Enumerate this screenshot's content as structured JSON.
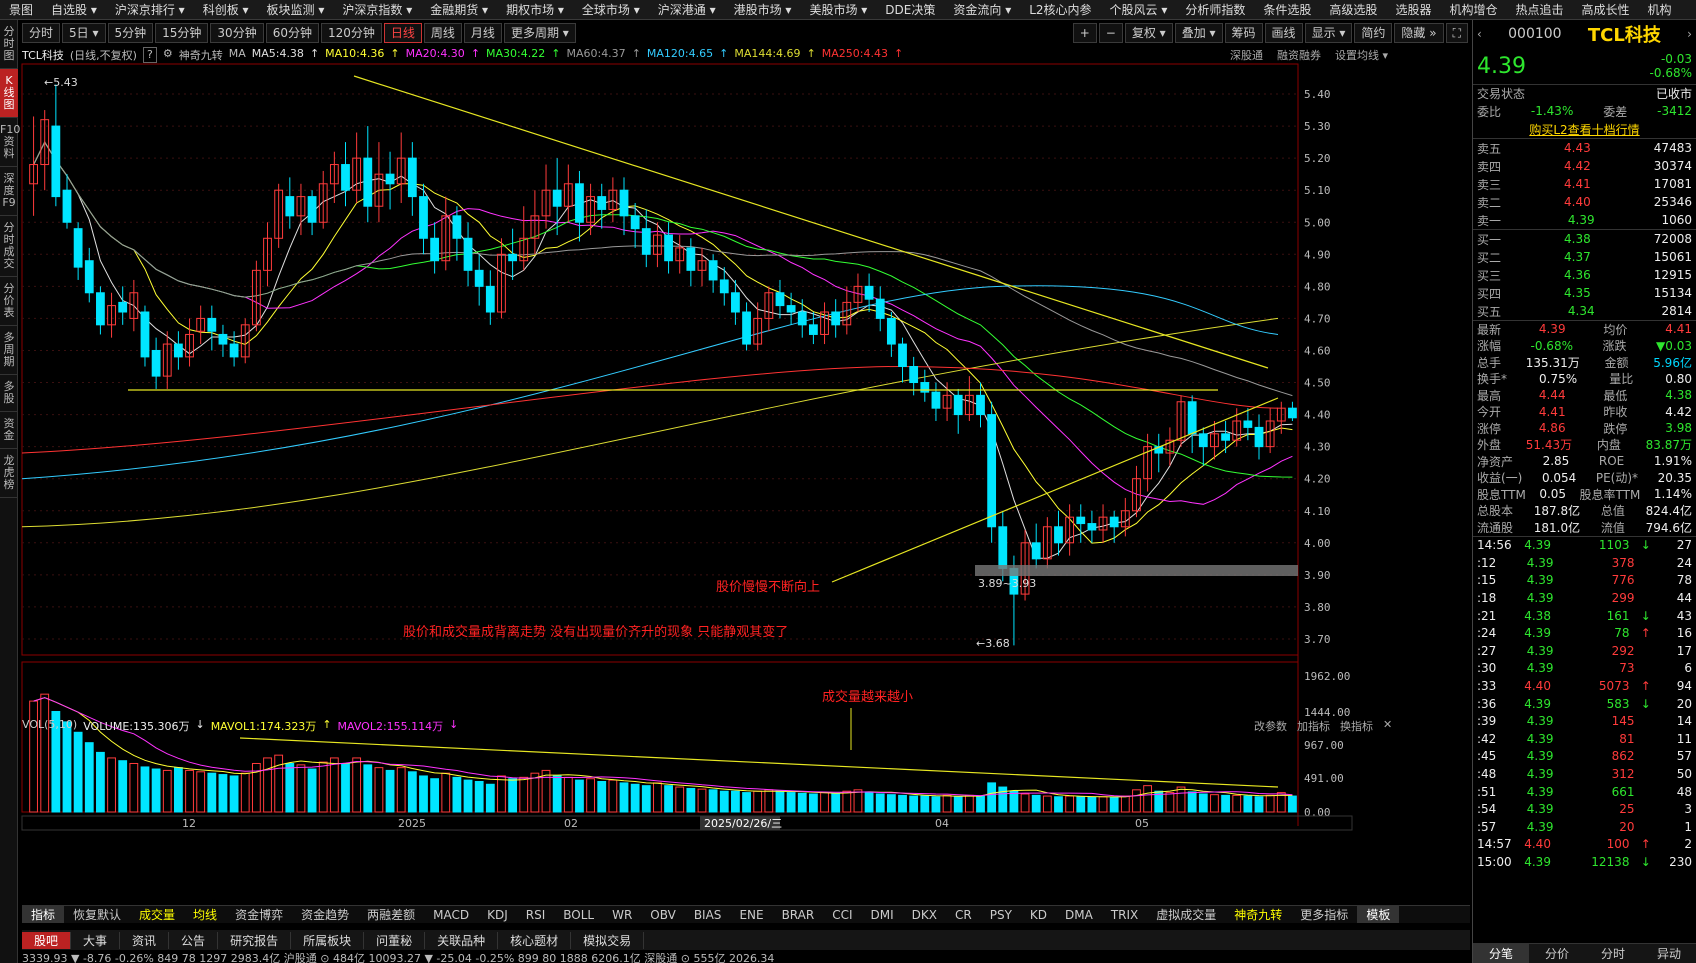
{
  "menu": [
    "景图",
    "自选股 ▾",
    "沪深京排行 ▾",
    "科创板 ▾",
    "板块监测 ▾",
    "沪深京指数 ▾",
    "金融期货 ▾",
    "期权市场 ▾",
    "全球市场 ▾",
    "沪深港通 ▾",
    "港股市场 ▾",
    "美股市场 ▾",
    "DDE决策",
    "资金流向 ▾",
    "L2核心内参",
    "个股风云 ▾",
    "分析师指数",
    "条件选股",
    "高级选股",
    "选股器",
    "机构增仓",
    "热点追击",
    "高成长性",
    "机构"
  ],
  "periods": [
    "分时",
    "5日 ▾",
    "5分钟",
    "15分钟",
    "30分钟",
    "60分钟",
    "120分钟",
    "日线",
    "周线",
    "月线",
    "更多周期 ▾"
  ],
  "active_period": "日线",
  "tools": [
    "+",
    "−",
    "复权 ▾",
    "叠加 ▾",
    "筹码",
    "画线",
    "显示 ▾",
    "简约",
    "隐藏 »",
    "⛶"
  ],
  "left_tabs": [
    "分时图",
    "K线图",
    "F10资料",
    "深度F9",
    "分时成交",
    "分价表",
    "多周期",
    "多股",
    "资金",
    "龙虎榜"
  ],
  "stock": {
    "name": "TCL科技",
    "mode": "(日线,不复权)",
    "code": "000100",
    "price": "4.39",
    "change": "-0.03",
    "pct": "-0.68%"
  },
  "indicator_name": "神奇九转",
  "ma_label": "MA",
  "ma_legend": [
    {
      "t": "MA5:4.38",
      "c": "#e0e0e0"
    },
    {
      "t": "MA10:4.36",
      "c": "#ffff33"
    },
    {
      "t": "MA20:4.30",
      "c": "#ff33ff"
    },
    {
      "t": "MA30:4.22",
      "c": "#33ff33"
    },
    {
      "t": "MA60:4.37",
      "c": "#999999"
    },
    {
      "t": "MA120:4.65",
      "c": "#33ccff"
    },
    {
      "t": "MA144:4.69",
      "c": "#dddd33"
    },
    {
      "t": "MA250:4.43",
      "c": "#ff3333"
    }
  ],
  "legend_right": [
    "深股通",
    "融资融券",
    "设置均线 ▾"
  ],
  "annotations": {
    "a1": "股价慢慢不断向上",
    "a2": "股价和成交量成背离走势 没有出现量价齐升的现象 只能静观其变了",
    "a3": "成交量越来越小",
    "box": "3.89~3.93",
    "high": "5.43",
    "low": "3.68"
  },
  "vol_legend": {
    "name": "VOL(5,10)",
    "v": "VOLUME:135.306万",
    "m1": "MAVOL1:174.323万",
    "m2": "MAVOL2:155.114万"
  },
  "vol_right": [
    "改参数",
    "加指标",
    "换指标"
  ],
  "date_cursor": "2025/02/26/三",
  "indicators": [
    "指标",
    "恢复默认",
    "成交量",
    "均线",
    "资金博弈",
    "资金趋势",
    "两融差额",
    "MACD",
    "KDJ",
    "RSI",
    "BOLL",
    "WR",
    "OBV",
    "BIAS",
    "ENE",
    "BRAR",
    "CCI",
    "DMI",
    "DKX",
    "CR",
    "PSY",
    "KD",
    "DMA",
    "TRIX",
    "虚拟成交量",
    "神奇九转",
    "更多指标",
    "模板"
  ],
  "bottom_tabs": [
    "股吧",
    "大事",
    "资讯",
    "公告",
    "研究报告",
    "所属板块",
    "问董秘",
    "关联品种",
    "核心题材",
    "模拟交易"
  ],
  "ticker": "3339.93   ▼ -8.76   -0.26%   849 78 1297   2983.4亿   沪股通 ⊙ 484亿   10093.27   ▼ -25.04   -0.25%   899 80 1888   6206.1亿   深股通 ⊙ 555亿   2026.34",
  "right": {
    "status_label": "交易状态",
    "status": "已收市",
    "weibi_label": "委比",
    "weibi": "-1.43%",
    "weicha_label": "委差",
    "weicha": "-3412",
    "buy_l2": "购买L2查看十档行情",
    "asks": [
      [
        "卖五",
        "4.43",
        "47483"
      ],
      [
        "卖四",
        "4.42",
        "30374"
      ],
      [
        "卖三",
        "4.41",
        "17081"
      ],
      [
        "卖二",
        "4.40",
        "25346"
      ],
      [
        "卖一",
        "4.39",
        "1060"
      ]
    ],
    "bids": [
      [
        "买一",
        "4.38",
        "72008"
      ],
      [
        "买二",
        "4.37",
        "15061"
      ],
      [
        "买三",
        "4.36",
        "12915"
      ],
      [
        "买四",
        "4.35",
        "15134"
      ],
      [
        "买五",
        "4.34",
        "2814"
      ]
    ],
    "stats": [
      [
        "最新",
        "4.39",
        "red",
        "均价",
        "4.41",
        "red"
      ],
      [
        "涨幅",
        "-0.68%",
        "green",
        "涨跌",
        "▼0.03",
        "green"
      ],
      [
        "总手",
        "135.31万",
        "white",
        "金额",
        "5.96亿",
        "cyan"
      ],
      [
        "换手*",
        "0.75%",
        "white",
        "量比",
        "0.80",
        "white"
      ],
      [
        "最高",
        "4.44",
        "red",
        "最低",
        "4.38",
        "green"
      ],
      [
        "今开",
        "4.41",
        "red",
        "昨收",
        "4.42",
        "white"
      ],
      [
        "涨停",
        "4.86",
        "red",
        "跌停",
        "3.98",
        "green"
      ],
      [
        "外盘",
        "51.43万",
        "red",
        "内盘",
        "83.87万",
        "green"
      ],
      [
        "净资产",
        "2.85",
        "white",
        "ROE",
        "1.91%",
        "white"
      ],
      [
        "收益(一)",
        "0.054",
        "white",
        "PE(动)*",
        "20.35",
        "white"
      ],
      [
        "股息TTM",
        "0.05",
        "white",
        "股息率TTM",
        "1.14%",
        "white"
      ],
      [
        "总股本",
        "187.8亿",
        "white",
        "总值",
        "824.4亿",
        "white"
      ],
      [
        "流通股",
        "181.0亿",
        "white",
        "流值",
        "794.6亿",
        "white"
      ]
    ],
    "ticks": [
      [
        "14:56",
        "4.39",
        "1103",
        "27",
        "green",
        "dn"
      ],
      [
        ":12",
        "4.39",
        "378",
        "24",
        "red",
        ""
      ],
      [
        ":15",
        "4.39",
        "776",
        "78",
        "red",
        ""
      ],
      [
        ":18",
        "4.39",
        "299",
        "44",
        "red",
        ""
      ],
      [
        ":21",
        "4.38",
        "161",
        "43",
        "green",
        "dn"
      ],
      [
        ":24",
        "4.39",
        "78",
        "16",
        "green",
        "up"
      ],
      [
        ":27",
        "4.39",
        "292",
        "17",
        "red",
        ""
      ],
      [
        ":30",
        "4.39",
        "73",
        "6",
        "red",
        ""
      ],
      [
        ":33",
        "4.40",
        "5073",
        "94",
        "red",
        "up"
      ],
      [
        ":36",
        "4.39",
        "583",
        "20",
        "green",
        "dn"
      ],
      [
        ":39",
        "4.39",
        "145",
        "14",
        "red",
        ""
      ],
      [
        ":42",
        "4.39",
        "81",
        "11",
        "red",
        ""
      ],
      [
        ":45",
        "4.39",
        "862",
        "57",
        "red",
        ""
      ],
      [
        ":48",
        "4.39",
        "312",
        "50",
        "red",
        ""
      ],
      [
        ":51",
        "4.39",
        "661",
        "48",
        "green",
        ""
      ],
      [
        ":54",
        "4.39",
        "25",
        "3",
        "red",
        ""
      ],
      [
        ":57",
        "4.39",
        "20",
        "1",
        "red",
        ""
      ],
      [
        "14:57",
        "4.40",
        "100",
        "2",
        "red",
        "up"
      ],
      [
        "15:00",
        "4.39",
        "12138",
        "230",
        "green",
        "dn"
      ]
    ],
    "tabs": [
      "分笔",
      "分价",
      "分时",
      "异动"
    ]
  },
  "chart_data": {
    "type": "candlestick",
    "price_axis": {
      "min": 3.65,
      "max": 5.45,
      "ticks": [
        "5.40",
        "5.30",
        "5.20",
        "5.10",
        "5.00",
        "4.90",
        "4.80",
        "4.70",
        "4.60",
        "4.50",
        "4.40",
        "4.30",
        "4.20",
        "4.10",
        "4.00",
        "3.90",
        "3.80",
        "3.70"
      ]
    },
    "volume_axis": {
      "max": 1962,
      "ticks": [
        "1962.00",
        "1444.00",
        "967.00",
        "491.00",
        "0.00"
      ]
    },
    "x_labels": [
      "12",
      "2025",
      "02",
      "04",
      "05"
    ],
    "candles": [
      [
        5.12,
        5.18,
        5.02,
        5.33
      ],
      [
        5.18,
        5.32,
        5.1,
        5.35
      ],
      [
        5.3,
        5.08,
        5.05,
        5.43
      ],
      [
        5.1,
        5.0,
        4.98,
        5.15
      ],
      [
        4.98,
        4.86,
        4.82,
        5.0
      ],
      [
        4.88,
        4.78,
        4.75,
        4.92
      ],
      [
        4.78,
        4.68,
        4.65,
        4.8
      ],
      [
        4.68,
        4.74,
        4.64,
        4.78
      ],
      [
        4.75,
        4.72,
        4.68,
        4.8
      ],
      [
        4.7,
        4.78,
        4.66,
        4.82
      ],
      [
        4.72,
        4.58,
        4.55,
        4.74
      ],
      [
        4.6,
        4.52,
        4.48,
        4.64
      ],
      [
        4.52,
        4.62,
        4.48,
        4.66
      ],
      [
        4.62,
        4.58,
        4.54,
        4.66
      ],
      [
        4.58,
        4.65,
        4.55,
        4.7
      ],
      [
        4.66,
        4.7,
        4.62,
        4.74
      ],
      [
        4.7,
        4.66,
        4.6,
        4.74
      ],
      [
        4.65,
        4.62,
        4.58,
        4.68
      ],
      [
        4.62,
        4.58,
        4.55,
        4.66
      ],
      [
        4.58,
        4.68,
        4.56,
        4.7
      ],
      [
        4.68,
        4.85,
        4.66,
        4.88
      ],
      [
        4.85,
        4.95,
        4.8,
        5.0
      ],
      [
        4.95,
        5.1,
        4.92,
        5.12
      ],
      [
        5.08,
        5.02,
        4.98,
        5.14
      ],
      [
        5.02,
        5.08,
        4.96,
        5.12
      ],
      [
        5.08,
        5.0,
        4.96,
        5.1
      ],
      [
        5.0,
        5.12,
        4.98,
        5.16
      ],
      [
        5.12,
        5.18,
        5.06,
        5.22
      ],
      [
        5.18,
        5.1,
        5.05,
        5.25
      ],
      [
        5.1,
        5.2,
        5.06,
        5.28
      ],
      [
        5.2,
        5.05,
        5.0,
        5.3
      ],
      [
        5.05,
        5.15,
        5.0,
        5.25
      ],
      [
        5.15,
        5.12,
        5.04,
        5.22
      ],
      [
        5.12,
        5.2,
        5.06,
        5.28
      ],
      [
        5.2,
        5.08,
        5.02,
        5.25
      ],
      [
        5.08,
        4.95,
        4.9,
        5.12
      ],
      [
        4.95,
        4.88,
        4.84,
        5.0
      ],
      [
        4.88,
        5.02,
        4.85,
        5.08
      ],
      [
        5.02,
        4.95,
        4.88,
        5.05
      ],
      [
        4.95,
        4.85,
        4.8,
        5.0
      ],
      [
        4.85,
        4.8,
        4.74,
        4.9
      ],
      [
        4.8,
        4.72,
        4.68,
        4.85
      ],
      [
        4.72,
        4.9,
        4.7,
        4.95
      ],
      [
        4.9,
        4.88,
        4.82,
        4.98
      ],
      [
        4.88,
        4.95,
        4.85,
        5.05
      ],
      [
        4.95,
        5.02,
        4.9,
        5.1
      ],
      [
        5.02,
        5.1,
        4.98,
        5.18
      ],
      [
        5.1,
        5.05,
        4.96,
        5.2
      ],
      [
        5.05,
        5.12,
        5.0,
        5.18
      ],
      [
        5.12,
        5.0,
        4.94,
        5.16
      ],
      [
        5.0,
        5.08,
        4.96,
        5.12
      ],
      [
        5.08,
        5.04,
        4.98,
        5.12
      ],
      [
        5.04,
        5.1,
        5.0,
        5.14
      ],
      [
        5.1,
        5.02,
        4.96,
        5.14
      ],
      [
        5.02,
        4.98,
        4.92,
        5.06
      ],
      [
        4.98,
        4.9,
        4.86,
        5.04
      ],
      [
        4.9,
        4.96,
        4.86,
        5.0
      ],
      [
        4.96,
        4.88,
        4.84,
        5.0
      ],
      [
        4.88,
        4.92,
        4.84,
        4.96
      ],
      [
        4.92,
        4.85,
        4.8,
        4.95
      ],
      [
        4.85,
        4.88,
        4.8,
        4.92
      ],
      [
        4.88,
        4.82,
        4.78,
        4.9
      ],
      [
        4.82,
        4.78,
        4.74,
        4.86
      ],
      [
        4.78,
        4.72,
        4.68,
        4.82
      ],
      [
        4.72,
        4.62,
        4.6,
        4.75
      ],
      [
        4.62,
        4.7,
        4.6,
        4.75
      ],
      [
        4.7,
        4.78,
        4.66,
        4.8
      ],
      [
        4.78,
        4.74,
        4.7,
        4.82
      ],
      [
        4.74,
        4.72,
        4.68,
        4.78
      ],
      [
        4.72,
        4.68,
        4.64,
        4.76
      ],
      [
        4.68,
        4.65,
        4.62,
        4.72
      ],
      [
        4.65,
        4.72,
        4.62,
        4.75
      ],
      [
        4.72,
        4.68,
        4.64,
        4.76
      ],
      [
        4.68,
        4.75,
        4.65,
        4.8
      ],
      [
        4.75,
        4.8,
        4.72,
        4.84
      ],
      [
        4.8,
        4.76,
        4.72,
        4.84
      ],
      [
        4.76,
        4.7,
        4.66,
        4.8
      ],
      [
        4.7,
        4.62,
        4.58,
        4.72
      ],
      [
        4.62,
        4.55,
        4.5,
        4.64
      ],
      [
        4.55,
        4.5,
        4.46,
        4.58
      ],
      [
        4.5,
        4.47,
        4.44,
        4.54
      ],
      [
        4.47,
        4.42,
        4.38,
        4.5
      ],
      [
        4.42,
        4.46,
        4.38,
        4.5
      ],
      [
        4.46,
        4.4,
        4.34,
        4.48
      ],
      [
        4.4,
        4.46,
        4.38,
        4.52
      ],
      [
        4.46,
        4.4,
        4.36,
        4.5
      ],
      [
        4.4,
        4.05,
        4.0,
        4.44
      ],
      [
        4.05,
        3.92,
        3.88,
        4.1
      ],
      [
        3.92,
        3.84,
        3.68,
        3.96
      ],
      [
        3.84,
        4.0,
        3.82,
        4.04
      ],
      [
        4.0,
        3.95,
        3.92,
        4.06
      ],
      [
        3.95,
        4.05,
        3.92,
        4.08
      ],
      [
        4.05,
        4.0,
        3.96,
        4.1
      ],
      [
        4.0,
        4.08,
        3.96,
        4.12
      ],
      [
        4.08,
        4.06,
        4.0,
        4.12
      ],
      [
        4.06,
        4.04,
        4.0,
        4.1
      ],
      [
        4.04,
        4.08,
        4.0,
        4.12
      ],
      [
        4.08,
        4.05,
        4.0,
        4.1
      ],
      [
        4.05,
        4.1,
        4.02,
        4.14
      ],
      [
        4.1,
        4.2,
        4.08,
        4.24
      ],
      [
        4.2,
        4.3,
        4.16,
        4.34
      ],
      [
        4.3,
        4.28,
        4.22,
        4.34
      ],
      [
        4.28,
        4.32,
        4.24,
        4.36
      ],
      [
        4.32,
        4.44,
        4.3,
        4.46
      ],
      [
        4.44,
        4.34,
        4.28,
        4.46
      ],
      [
        4.34,
        4.3,
        4.24,
        4.36
      ],
      [
        4.3,
        4.34,
        4.26,
        4.38
      ],
      [
        4.34,
        4.32,
        4.28,
        4.38
      ],
      [
        4.32,
        4.38,
        4.3,
        4.42
      ],
      [
        4.38,
        4.36,
        4.32,
        4.42
      ],
      [
        4.36,
        4.3,
        4.26,
        4.4
      ],
      [
        4.3,
        4.38,
        4.28,
        4.42
      ],
      [
        4.38,
        4.42,
        4.34,
        4.44
      ],
      [
        4.42,
        4.39,
        4.38,
        4.44
      ]
    ],
    "volumes": [
      1600,
      1700,
      1450,
      1300,
      1150,
      1000,
      860,
      780,
      740,
      700,
      650,
      620,
      600,
      640,
      600,
      580,
      560,
      540,
      520,
      560,
      700,
      780,
      820,
      700,
      680,
      620,
      720,
      780,
      700,
      780,
      680,
      640,
      600,
      640,
      580,
      520,
      480,
      560,
      500,
      460,
      440,
      400,
      520,
      480,
      500,
      560,
      600,
      520,
      500,
      460,
      480,
      440,
      460,
      420,
      400,
      380,
      420,
      380,
      360,
      340,
      330,
      320,
      300,
      300,
      280,
      300,
      320,
      300,
      280,
      270,
      260,
      280,
      260,
      300,
      320,
      290,
      260,
      250,
      240,
      230,
      230,
      220,
      240,
      220,
      240,
      230,
      420,
      360,
      300,
      260,
      240,
      230,
      220,
      230,
      220,
      210,
      220,
      210,
      230,
      320,
      380,
      300,
      280,
      360,
      290,
      260,
      250,
      240,
      240,
      230,
      220,
      240,
      280,
      230
    ]
  }
}
